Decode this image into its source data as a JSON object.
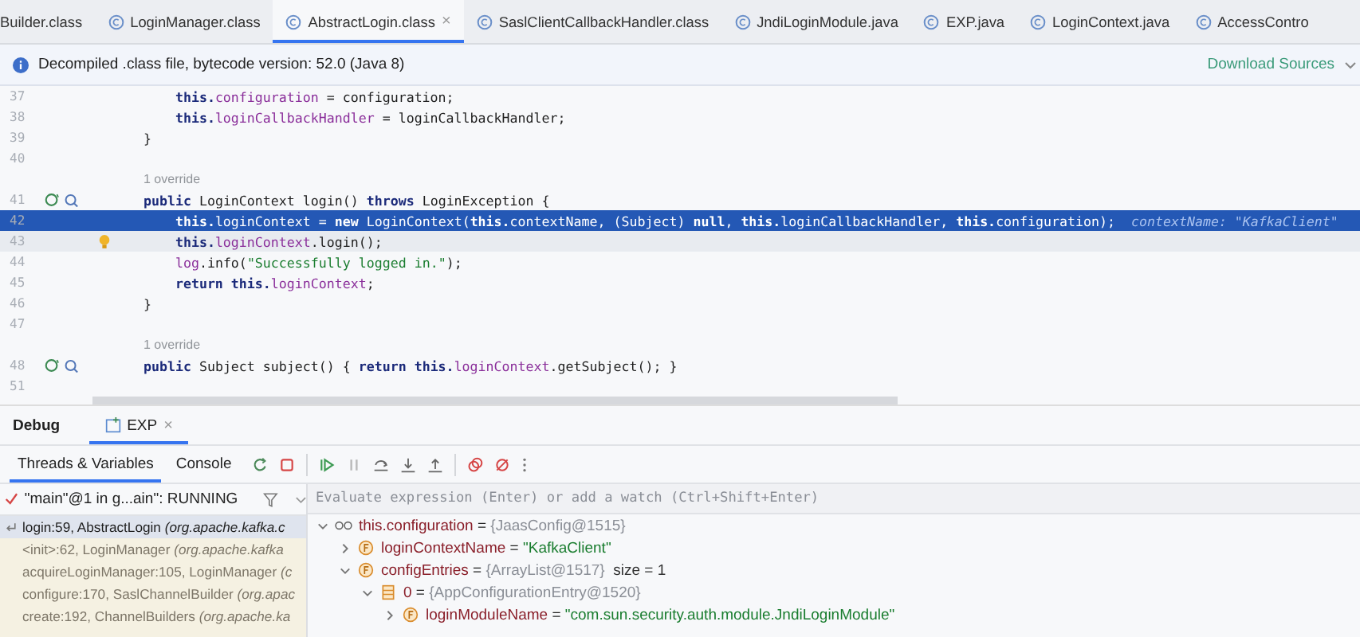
{
  "tabs": [
    {
      "label": "Builder.class",
      "kind": "cut",
      "selected": false
    },
    {
      "label": "LoginManager.class",
      "kind": "class",
      "selected": false
    },
    {
      "label": "AbstractLogin.class",
      "kind": "class",
      "selected": true,
      "close": "×"
    },
    {
      "label": "SaslClientCallbackHandler.class",
      "kind": "class",
      "selected": false
    },
    {
      "label": "JndiLoginModule.java",
      "kind": "class",
      "selected": false
    },
    {
      "label": "EXP.java",
      "kind": "class",
      "selected": false
    },
    {
      "label": "LoginContext.java",
      "kind": "class",
      "selected": false
    },
    {
      "label": "AccessContro",
      "kind": "class",
      "selected": false
    }
  ],
  "info_bar": {
    "message": "Decompiled .class file, bytecode version: 52.0 (Java 8)",
    "link": "Download Sources"
  },
  "editor": {
    "lines": [
      {
        "kind": "code",
        "number": "37",
        "selected": false,
        "current": false,
        "tokens": [
          {
            "kind": "kw",
            "t": "        this."
          },
          {
            "kind": "f",
            "t": "configuration"
          },
          {
            "kind": "p",
            "t": " = configuration;"
          }
        ]
      },
      {
        "kind": "code",
        "number": "38",
        "selected": false,
        "current": false,
        "tokens": [
          {
            "kind": "kw",
            "t": "        this."
          },
          {
            "kind": "f",
            "t": "loginCallbackHandler"
          },
          {
            "kind": "p",
            "t": " = loginCallbackHandler;"
          }
        ]
      },
      {
        "kind": "code",
        "number": "39",
        "selected": false,
        "current": false,
        "tokens": [
          {
            "kind": "p",
            "t": "    }"
          }
        ]
      },
      {
        "kind": "code",
        "number": "40",
        "selected": false,
        "current": false
      },
      {
        "kind": "hint",
        "text": "1 override"
      },
      {
        "kind": "code",
        "number": "41",
        "gutter": {
          "kind": "override"
        },
        "selected": false,
        "current": false,
        "tokens": [
          {
            "kind": "kw",
            "t": "    public "
          },
          {
            "kind": "p",
            "t": "LoginContext login() "
          },
          {
            "kind": "kw",
            "t": "throws "
          },
          {
            "kind": "p",
            "t": "LoginException {"
          }
        ]
      },
      {
        "kind": "code",
        "number": "42",
        "selected": true,
        "current": false,
        "tokens": [
          {
            "kind": "kw",
            "t": "        this."
          },
          {
            "kind": "f",
            "t": "loginContext"
          },
          {
            "kind": "p",
            "t": " = "
          },
          {
            "kind": "kw",
            "t": "new "
          },
          {
            "kind": "p",
            "t": "LoginContext("
          },
          {
            "kind": "kw",
            "t": "this."
          },
          {
            "kind": "f",
            "t": "contextName"
          },
          {
            "kind": "p",
            "t": ", (Subject) "
          },
          {
            "kind": "kw",
            "t": "null"
          },
          {
            "kind": "p",
            "t": ", "
          },
          {
            "kind": "kw",
            "t": "this."
          },
          {
            "kind": "f",
            "t": "loginCallbackHandler"
          },
          {
            "kind": "p",
            "t": ", "
          },
          {
            "kind": "kw",
            "t": "this."
          },
          {
            "kind": "f",
            "t": "configuration"
          },
          {
            "kind": "p",
            "t": ");"
          }
        ],
        "inline_value": "contextName: \"KafkaClient\""
      },
      {
        "kind": "code",
        "number": "43",
        "gutter": {
          "kind": "bulb"
        },
        "selected": false,
        "current": true,
        "tokens": [
          {
            "kind": "kw",
            "t": "        this."
          },
          {
            "kind": "f",
            "t": "loginContext"
          },
          {
            "kind": "p",
            "t": ".login();"
          }
        ]
      },
      {
        "kind": "code",
        "number": "44",
        "selected": false,
        "current": false,
        "tokens": [
          {
            "kind": "f",
            "t": "        log"
          },
          {
            "kind": "p",
            "t": ".info("
          },
          {
            "kind": "s",
            "t": "\"Successfully logged in.\""
          },
          {
            "kind": "p",
            "t": ");"
          }
        ]
      },
      {
        "kind": "code",
        "number": "45",
        "selected": false,
        "current": false,
        "tokens": [
          {
            "kind": "kw",
            "t": "        return this."
          },
          {
            "kind": "f",
            "t": "loginContext"
          },
          {
            "kind": "p",
            "t": ";"
          }
        ]
      },
      {
        "kind": "code",
        "number": "46",
        "selected": false,
        "current": false,
        "tokens": [
          {
            "kind": "p",
            "t": "    }"
          }
        ]
      },
      {
        "kind": "code",
        "number": "47",
        "selected": false,
        "current": false
      },
      {
        "kind": "hint",
        "text": "1 override"
      },
      {
        "kind": "code",
        "number": "48",
        "gutter": {
          "kind": "override"
        },
        "selected": false,
        "current": false,
        "tokens": [
          {
            "kind": "kw",
            "t": "    public "
          },
          {
            "kind": "p",
            "t": "Subject subject() { "
          },
          {
            "kind": "kw",
            "t": "return this."
          },
          {
            "kind": "f",
            "t": "loginContext"
          },
          {
            "kind": "p",
            "t": ".getSubject(); }"
          }
        ]
      },
      {
        "kind": "code",
        "number": "51",
        "selected": false,
        "current": false
      }
    ]
  },
  "debug": {
    "title": "Debug",
    "session_tab": {
      "label": "EXP",
      "selected": true,
      "close": "×"
    },
    "subtabs": [
      {
        "label": "Threads & Variables",
        "selected": true
      },
      {
        "label": "Console",
        "selected": false
      }
    ],
    "thread": {
      "label": "\"main\"@1 in g...ain\": RUNNING"
    },
    "frames": [
      {
        "method": "login:59, AbstractLogin",
        "package": "(org.apache.kafka.c",
        "selected": true
      },
      {
        "method": "<init>:62, LoginManager",
        "package": "(org.apache.kafka",
        "selected": false
      },
      {
        "method": "acquireLoginManager:105, LoginManager",
        "package": "(c",
        "selected": false
      },
      {
        "method": "configure:170, SaslChannelBuilder",
        "package": "(org.apac",
        "selected": false
      },
      {
        "method": "create:192, ChannelBuilders",
        "package": "(org.apache.ka",
        "selected": false
      }
    ],
    "evaluate": {
      "placeholder": "Evaluate expression (Enter) or add a watch (Ctrl+Shift+Enter)"
    },
    "variables": [
      {
        "kind": "watch",
        "name": "this.configuration",
        "op": "=",
        "value": {
          "kind": "object",
          "text": "{JaasConfig@1515}"
        },
        "expanded": true,
        "children": [
          {
            "kind": "field",
            "name": "loginContextName",
            "op": "=",
            "value": {
              "kind": "string",
              "text": "\"KafkaClient\""
            },
            "expanded": false
          },
          {
            "kind": "field",
            "name": "configEntries",
            "op": "=",
            "value": {
              "kind": "object",
              "text": "{ArrayList@1517}"
            },
            "note": "size = 1",
            "expanded": true,
            "children": [
              {
                "kind": "array",
                "name": "0",
                "op": "=",
                "value": {
                  "kind": "object",
                  "text": "{AppConfigurationEntry@1520}"
                },
                "expanded": true,
                "children": [
                  {
                    "kind": "field",
                    "name": "loginModuleName",
                    "op": "=",
                    "value": {
                      "kind": "string",
                      "text": "\"com.sun.security.auth.module.JndiLoginModule\""
                    },
                    "expanded": false
                  }
                ]
              }
            ]
          }
        ]
      }
    ]
  }
}
